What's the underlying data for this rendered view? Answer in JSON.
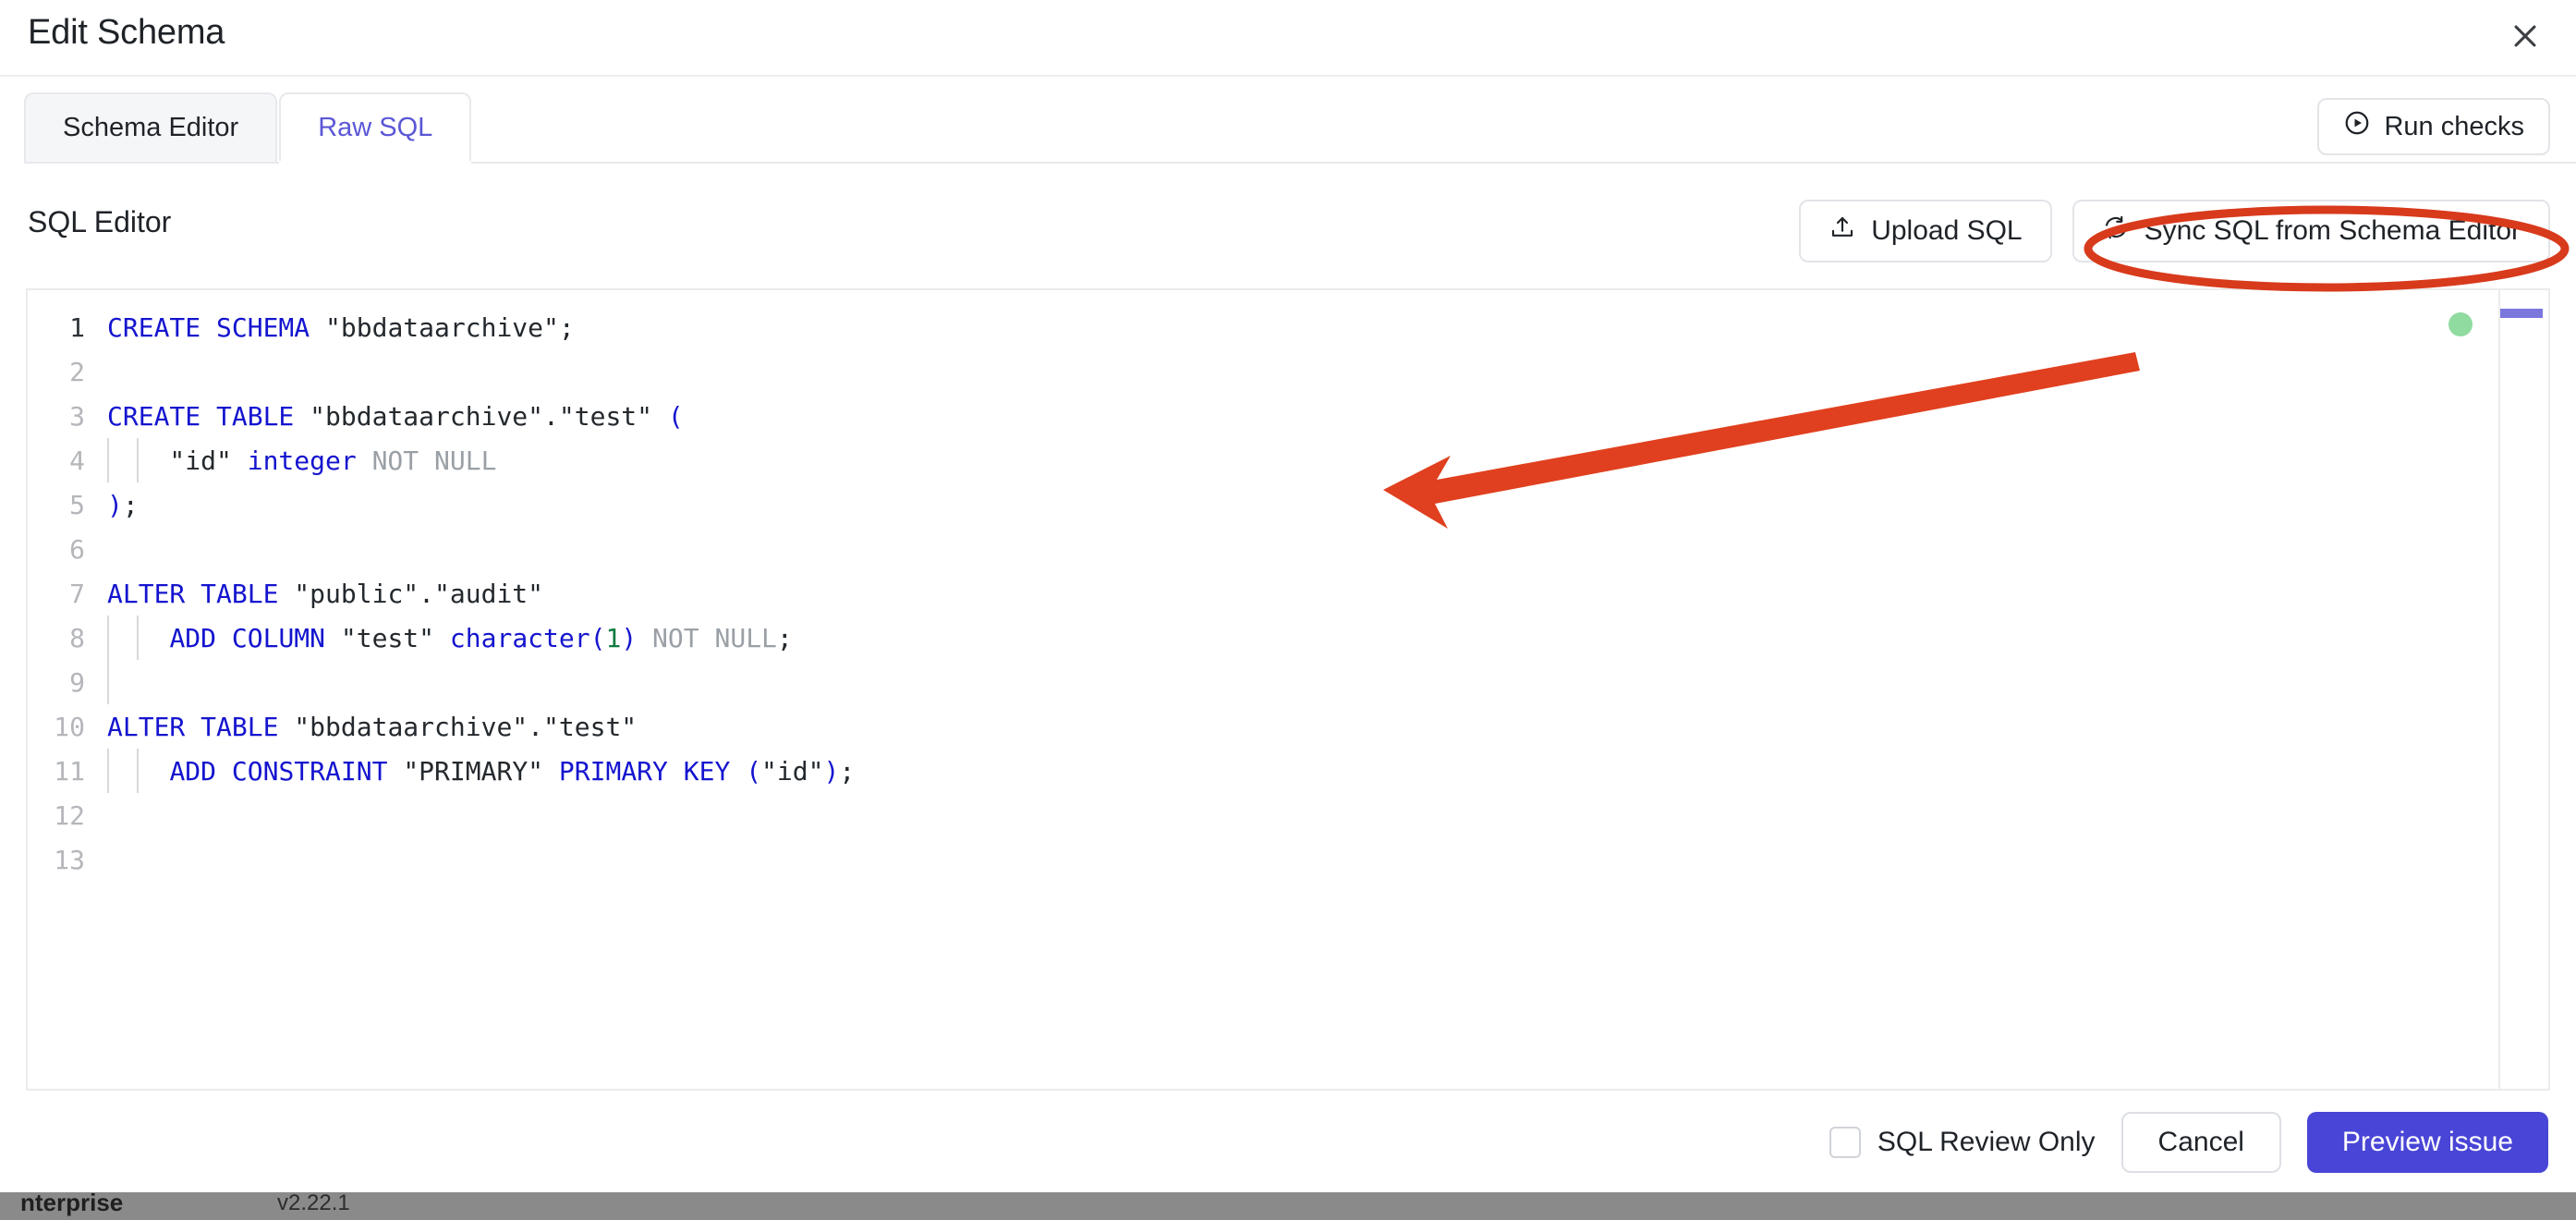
{
  "window": {
    "title": "Edit Schema",
    "close_icon": "close-icon"
  },
  "tabs": [
    {
      "label": "Schema Editor",
      "active": false
    },
    {
      "label": "Raw SQL",
      "active": true
    }
  ],
  "header_actions": {
    "run_checks": {
      "label": "Run checks",
      "icon": "play-circle-icon"
    }
  },
  "editor_section": {
    "label": "SQL Editor",
    "actions": [
      {
        "label": "Upload SQL",
        "icon": "upload-icon"
      },
      {
        "label": "Sync SQL from Schema Editor",
        "icon": "sync-icon",
        "highlighted": true
      }
    ],
    "status_dot_color": "#8fdba0",
    "minimap_marker_color": "#7b77dd"
  },
  "code": {
    "language": "sql",
    "total_lines": 13,
    "current_line": 1,
    "lines": [
      {
        "num": "1",
        "indent": 0,
        "tokens": [
          {
            "t": "CREATE SCHEMA ",
            "c": "k"
          },
          {
            "t": "\"bbdataarchive\"",
            "c": "s"
          },
          {
            "t": ";",
            "c": "pd"
          }
        ]
      },
      {
        "num": "2",
        "indent": 0,
        "tokens": []
      },
      {
        "num": "3",
        "indent": 0,
        "tokens": [
          {
            "t": "CREATE TABLE ",
            "c": "k"
          },
          {
            "t": "\"bbdataarchive\".\"test\" ",
            "c": "s"
          },
          {
            "t": "(",
            "c": "p"
          }
        ]
      },
      {
        "num": "4",
        "indent": 2,
        "tokens": [
          {
            "t": "    \"id\" ",
            "c": "s"
          },
          {
            "t": "integer ",
            "c": "k"
          },
          {
            "t": "NOT NULL",
            "c": "g"
          }
        ]
      },
      {
        "num": "5",
        "indent": 0,
        "tokens": [
          {
            "t": ")",
            "c": "p"
          },
          {
            "t": ";",
            "c": "pd"
          }
        ]
      },
      {
        "num": "6",
        "indent": 0,
        "tokens": []
      },
      {
        "num": "7",
        "indent": 0,
        "tokens": [
          {
            "t": "ALTER TABLE ",
            "c": "k"
          },
          {
            "t": "\"public\".\"audit\"",
            "c": "s"
          }
        ]
      },
      {
        "num": "8",
        "indent": 2,
        "tokens": [
          {
            "t": "    ",
            "c": "s"
          },
          {
            "t": "ADD COLUMN ",
            "c": "k"
          },
          {
            "t": "\"test\" ",
            "c": "s"
          },
          {
            "t": "character",
            "c": "k"
          },
          {
            "t": "(",
            "c": "p"
          },
          {
            "t": "1",
            "c": "n"
          },
          {
            "t": ") ",
            "c": "p"
          },
          {
            "t": "NOT NULL",
            "c": "g"
          },
          {
            "t": ";",
            "c": "pd"
          }
        ]
      },
      {
        "num": "9",
        "indent": 1,
        "tokens": []
      },
      {
        "num": "10",
        "indent": 0,
        "tokens": [
          {
            "t": "ALTER TABLE ",
            "c": "k"
          },
          {
            "t": "\"bbdataarchive\".\"test\"",
            "c": "s"
          }
        ]
      },
      {
        "num": "11",
        "indent": 2,
        "tokens": [
          {
            "t": "    ",
            "c": "s"
          },
          {
            "t": "ADD CONSTRAINT ",
            "c": "k"
          },
          {
            "t": "\"PRIMARY\" ",
            "c": "s"
          },
          {
            "t": "PRIMARY KEY ",
            "c": "k"
          },
          {
            "t": "(",
            "c": "p"
          },
          {
            "t": "\"id\"",
            "c": "s"
          },
          {
            "t": ")",
            "c": "p"
          },
          {
            "t": ";",
            "c": "pd"
          }
        ]
      },
      {
        "num": "12",
        "indent": 0,
        "tokens": []
      },
      {
        "num": "13",
        "indent": 0,
        "tokens": []
      }
    ]
  },
  "footer": {
    "sql_review_only": {
      "label": "SQL Review Only",
      "checked": false
    },
    "cancel": "Cancel",
    "primary": "Preview issue",
    "primary_color": "#4945d6"
  },
  "background": {
    "app_name_partial": "nterprise",
    "version_partial": "v2.22.1"
  },
  "annotations": {
    "arrow_color": "#e0401f",
    "ellipse_color": "#d83a1c",
    "arrow_target": "sync-sql-from-schema-editor-button",
    "ellipse_target": "sync-sql-from-schema-editor-button"
  }
}
